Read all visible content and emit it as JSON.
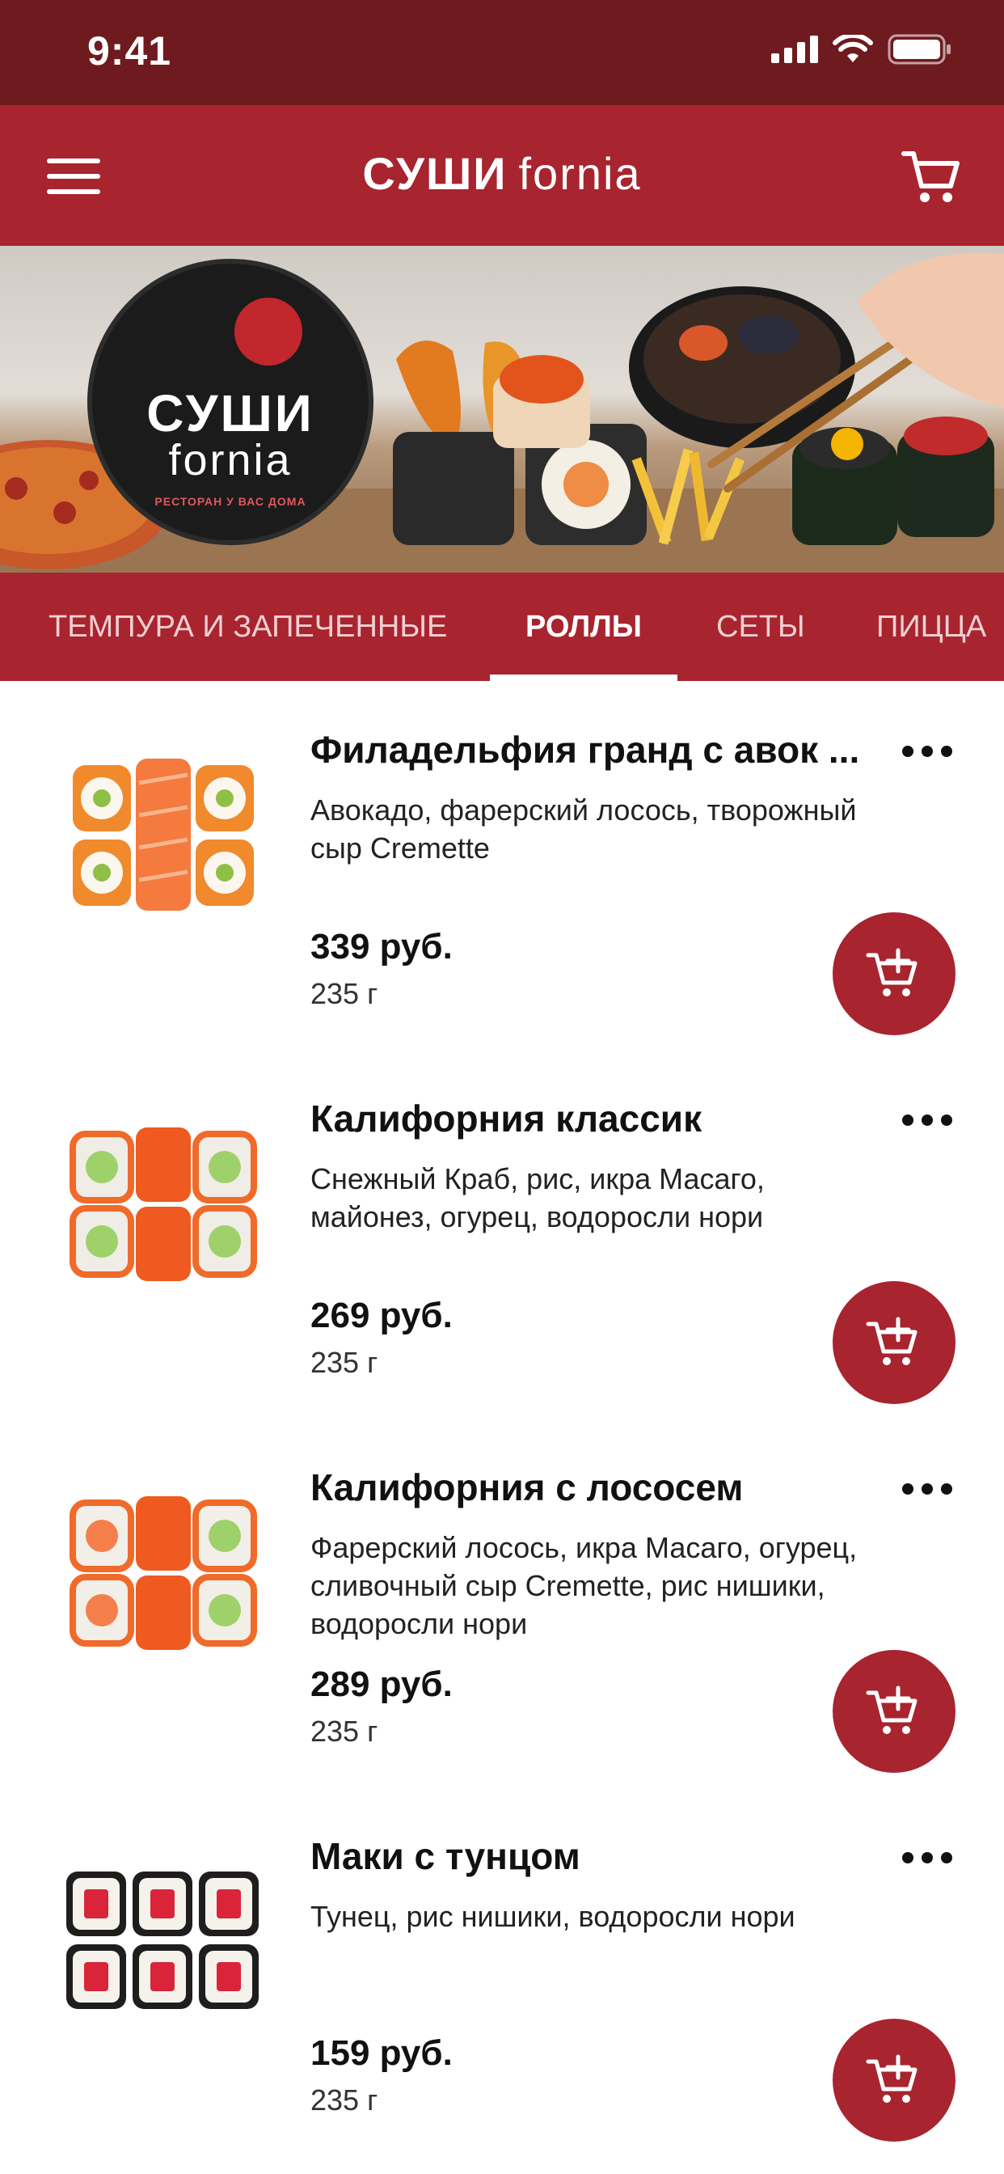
{
  "status_bar": {
    "time": "9:41"
  },
  "header": {
    "brand_part1": "СУШИ",
    "brand_part2": "fornia"
  },
  "banner": {
    "logo_line1": "СУШИ",
    "logo_line2": "fornia",
    "logo_tagline": "РЕСТОРАН У ВАС ДОМА"
  },
  "tabs": [
    {
      "label": "ТЕМПУРА И ЗАПЕЧЕННЫЕ",
      "active": false
    },
    {
      "label": "РОЛЛЫ",
      "active": true
    },
    {
      "label": "СЕТЫ",
      "active": false
    },
    {
      "label": "ПИЦЦА",
      "active": false
    }
  ],
  "items": [
    {
      "name": "Филадельфия гранд с авок ...",
      "description": "Авокадо, фарерский лосось, творожный сыр Cremette",
      "price": "339 руб.",
      "weight": "235 г"
    },
    {
      "name": "Калифорния классик",
      "description": "Снежный Краб, рис, икра Масаго, майонез, огурец, водоросли нори",
      "price": "269 руб.",
      "weight": "235 г"
    },
    {
      "name": "Калифорния с лососем",
      "description": "Фарерский лосось, икра Масаго, огурец, сливочный сыр Cremette, рис нишики, водоросли нори",
      "price": "289 руб.",
      "weight": "235 г"
    },
    {
      "name": "Маки с тунцом",
      "description": "Тунец, рис нишики, водоросли нори",
      "price": "159 руб.",
      "weight": "235 г"
    }
  ],
  "colors": {
    "status_bar": "#6e1a1f",
    "brand_red": "#a8242f",
    "text": "#111111"
  }
}
